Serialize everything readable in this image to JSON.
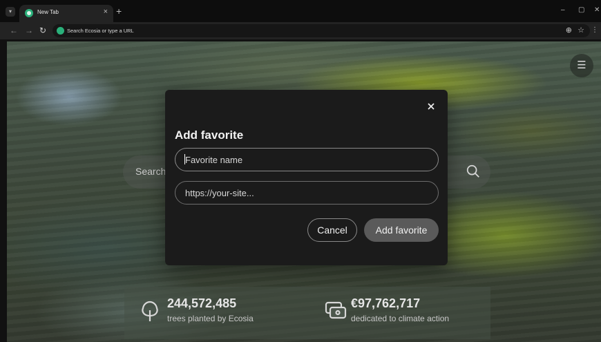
{
  "browser": {
    "tab_title": "New Tab",
    "tab_close": "×",
    "new_tab": "+",
    "address_placeholder": "Search Ecosia or type a URL",
    "window_controls": {
      "minimize": "–",
      "restore": "▢",
      "close": "✕"
    }
  },
  "page": {
    "search_placeholder": "Search",
    "stats": [
      {
        "value": "244,572,485",
        "label": "trees planted by Ecosia"
      },
      {
        "value": "€97,762,717",
        "label": "dedicated to climate action"
      }
    ]
  },
  "modal": {
    "title": "Add favorite",
    "name_placeholder": "Favorite name",
    "url_placeholder": "https://your-site...",
    "cancel_label": "Cancel",
    "submit_label": "Add favorite"
  },
  "colors": {
    "accent": "#2ab07a",
    "modal_bg": "#1b1b1b",
    "primary_button": "#5a5a5a"
  },
  "icons": [
    "chevron-down-icon",
    "ecosia-icon",
    "close-icon",
    "plus-icon",
    "back-icon",
    "forward-icon",
    "reload-icon",
    "zoom-icon",
    "star-icon",
    "kebab-menu-icon",
    "hamburger-menu-icon",
    "search-icon",
    "tree-icon",
    "money-icon"
  ]
}
